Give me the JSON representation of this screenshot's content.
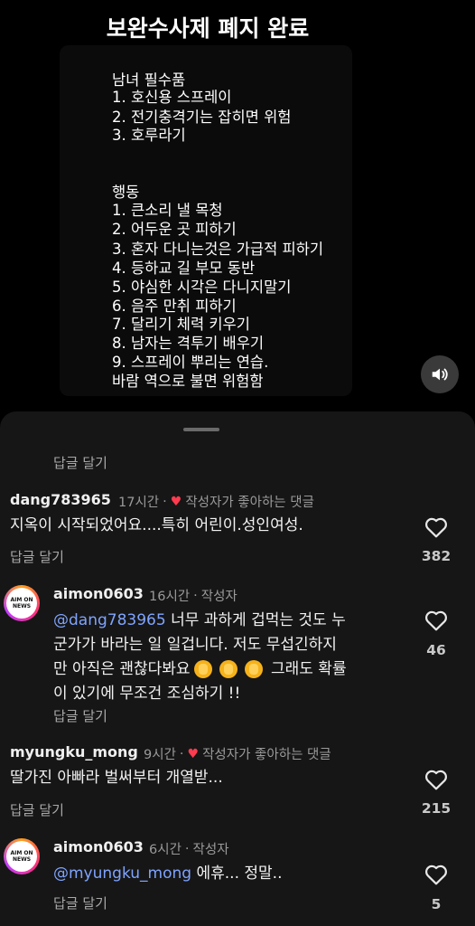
{
  "video": {
    "title": "보완수사제 폐지 완료",
    "lines": [
      "남녀 필수품",
      "1. 호신용 스프레이",
      "2. 전기충격기는 잡히면 위험",
      "3. 호루라기",
      "",
      "",
      "행동",
      "1. 큰소리 낼 목청",
      "2. 어두운 곳 피하기",
      "3. 혼자 다니는것은 가급적 피하기",
      "4. 등하교 길 부모 동반",
      "5. 야심한 시각은 다니지말기",
      "6. 음주 만취 피하기",
      "7. 달리기 체력 키우기",
      "8. 남자는 격투기 배우기",
      "9. 스프레이 뿌리는 연습.",
      "바람 역으로 불면 위험함"
    ]
  },
  "comments": {
    "top_reply_label": "답글 달기",
    "items": [
      {
        "username": "dang783965",
        "time": "17시간",
        "badge": "작성자가 좋아하는 댓글",
        "text": "지옥이 시작되었어요....특히 어린이.성인여성.",
        "reply_label": "답글 달기",
        "likes": "382"
      },
      {
        "username": "aimon0603",
        "time": "16시간",
        "badge": "작성자",
        "avatar_text": [
          "AIM ON",
          "NEWS"
        ],
        "mention": "@dang783965",
        "text_l1": " 너무 과하게 겁먹는 것도 누",
        "text_l2": "군가가 바라는 일 일겁니다. 저도 무섭긴하지",
        "text_l3a": "만 아직은 괜찮다봐요",
        "text_l3b": " 그래도 확률",
        "text_l4": "이 있기에 무조건 조심하기 !!",
        "reply_label": "답글 달기",
        "likes": "46"
      },
      {
        "username": "myungku_mong",
        "time": "9시간",
        "badge": "작성자가 좋아하는 댓글",
        "text": "딸가진 아빠라 벌써부터 개열받...",
        "reply_label": "답글 달기",
        "likes": "215"
      },
      {
        "username": "aimon0603",
        "time": "6시간",
        "badge": "작성자",
        "avatar_text": [
          "AIM ON",
          "NEWS"
        ],
        "mention": "@myungku_mong",
        "text": " 에휴... 정말..",
        "reply_label": "답글 달기",
        "likes": "5"
      }
    ]
  },
  "icons": {
    "heart_outline": "heart-outline-icon",
    "sound": "speaker-icon",
    "heart_filled": "heart-filled-icon",
    "clap": "clapping-hands-emoji"
  },
  "colors": {
    "mention": "#7fa4ff",
    "heart": "#ff3b4f",
    "sheet": "#161616"
  }
}
